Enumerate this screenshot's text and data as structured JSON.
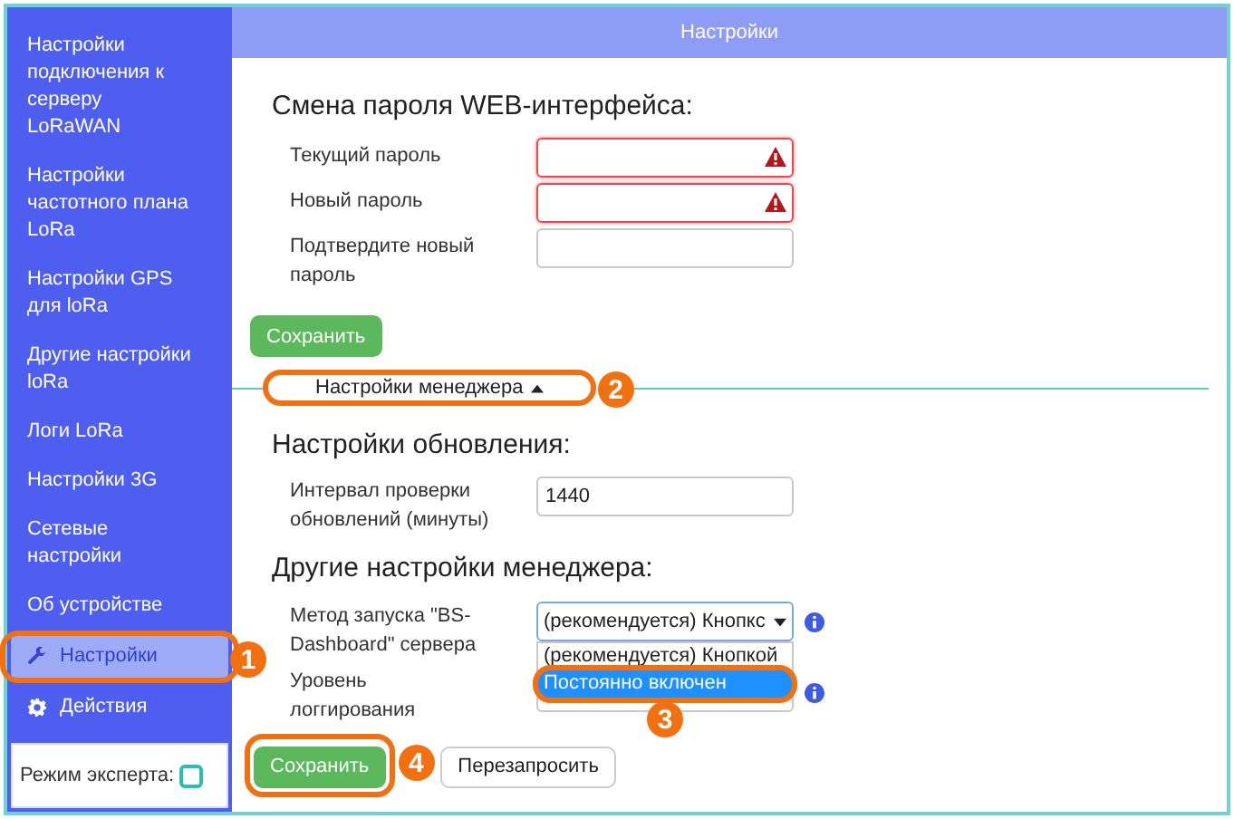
{
  "sidebar": {
    "items": [
      {
        "label": "Настройки подключения к серверу LoRaWAN",
        "selected": false,
        "kind": "plain"
      },
      {
        "label": "Настройки частотного плана LoRa",
        "selected": false,
        "kind": "plain"
      },
      {
        "label": "Настройки GPS для loRa",
        "selected": false,
        "kind": "plain"
      },
      {
        "label": "Другие настройки loRa",
        "selected": false,
        "kind": "plain"
      },
      {
        "label": "Логи LoRa",
        "selected": false,
        "kind": "plain"
      },
      {
        "label": "Настройки 3G",
        "selected": false,
        "kind": "plain"
      },
      {
        "label": "Сетевые настройки",
        "selected": false,
        "kind": "plain"
      },
      {
        "label": "Об устройстве",
        "selected": false,
        "kind": "plain"
      },
      {
        "label": "Настройки",
        "selected": true,
        "kind": "settings",
        "callout": "1"
      },
      {
        "label": "Действия",
        "selected": false,
        "kind": "actions"
      }
    ],
    "expert_mode": {
      "label": "Режим эксперта:",
      "checked": false
    }
  },
  "header": {
    "title": "Настройки"
  },
  "password_section": {
    "title": "Смена пароля WEB-интерфейса:",
    "fields": [
      {
        "label": "Текущий пароль",
        "error": true
      },
      {
        "label": "Новый пароль",
        "error": true
      },
      {
        "label": "Подтвердите новый пароль",
        "error": false
      }
    ],
    "save_button": "Сохранить"
  },
  "manager_toggle": {
    "label": "Настройки менеджера",
    "expanded": true,
    "callout": "2"
  },
  "update_section": {
    "title": "Настройки обновления:",
    "fields": [
      {
        "label": "Интервал проверки обновлений (минуты)",
        "value": "1440"
      }
    ]
  },
  "other_section": {
    "title": "Другие настройки менеджера:",
    "launch_field": {
      "label": "Метод запуска \"BS-Dashboard\" сервера",
      "value": "(рекомендуется) Кнопкс",
      "open": true,
      "options": [
        {
          "label": "(рекомендуется) Кнопкой",
          "selected": false
        },
        {
          "label": "Постоянно включен",
          "selected": true,
          "callout": "3"
        }
      ]
    },
    "log_field": {
      "label": "Уровень логгирования"
    }
  },
  "buttons": [
    {
      "label": "Сохранить",
      "kind": "primary",
      "callout": "4"
    },
    {
      "label": "Перезапросить",
      "kind": "secondary"
    }
  ]
}
